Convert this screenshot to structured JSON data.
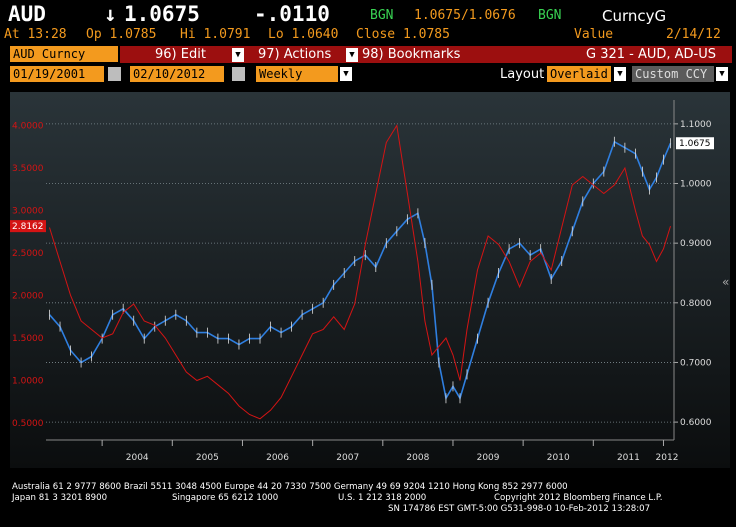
{
  "ticker": {
    "symbol": "AUD",
    "arrow": "↓",
    "price": "1.0675",
    "change": "-.0110",
    "source1": "BGN",
    "bidask": "1.0675/1.0676",
    "source2": "BGN",
    "function": "CurncyG"
  },
  "quote": {
    "time_label": "At 13:28",
    "open": "Op 1.0785",
    "high": "Hi 1.0791",
    "low": "Lo 1.0640",
    "close": "Close 1.0785",
    "value_label": "Value",
    "value_date": "2/14/12"
  },
  "menu": {
    "security": "AUD Curncy",
    "edit": "96) Edit",
    "actions": "97) Actions",
    "bookmarks": "98) Bookmarks",
    "chart_id": "G 321 - AUD, AD-US"
  },
  "range": {
    "start_date": "01/19/2001",
    "end_date": "02/10/2012",
    "period": "Weekly",
    "layout_label": "Layout",
    "layout_value": "Overlaid",
    "currency_value": "Custom CCY"
  },
  "colors": {
    "orange": "#f39a1e",
    "menu_red": "#9c0f0f",
    "series_aud": "#2f7fe0",
    "series_spread": "#d41414",
    "price_tag": "#ffffff",
    "left_tag": "#d41414"
  },
  "chart_data": {
    "type": "line",
    "x_ticks": [
      "2004",
      "2005",
      "2006",
      "2007",
      "2008",
      "2009",
      "2010",
      "2011",
      "2012"
    ],
    "left_axis": {
      "ticks": [
        "0.5000",
        "1.0000",
        "1.5000",
        "2.0000",
        "2.5000",
        "3.0000",
        "3.5000",
        "4.0000"
      ],
      "range": [
        0.3,
        4.3
      ],
      "current_tag": "2.8162"
    },
    "right_axis": {
      "ticks": [
        "0.6000",
        "0.7000",
        "0.8000",
        "0.9000",
        "1.0000",
        "1.1000"
      ],
      "range": [
        0.57,
        1.14
      ],
      "current_tag": "1.0675"
    },
    "series": [
      {
        "axis": "right",
        "x": [
          2003.25,
          2003.4,
          2003.55,
          2003.7,
          2003.85,
          2004.0,
          2004.15,
          2004.3,
          2004.45,
          2004.6,
          2004.75,
          2004.9,
          2005.05,
          2005.2,
          2005.35,
          2005.5,
          2005.65,
          2005.8,
          2005.95,
          2006.1,
          2006.25,
          2006.4,
          2006.55,
          2006.7,
          2006.85,
          2007.0,
          2007.15,
          2007.3,
          2007.45,
          2007.6,
          2007.75,
          2007.9,
          2008.05,
          2008.2,
          2008.35,
          2008.5,
          2008.6,
          2008.7,
          2008.8,
          2008.9,
          2009.0,
          2009.1,
          2009.2,
          2009.35,
          2009.5,
          2009.65,
          2009.8,
          2009.95,
          2010.1,
          2010.25,
          2010.4,
          2010.55,
          2010.7,
          2010.85,
          2011.0,
          2011.15,
          2011.3,
          2011.45,
          2011.6,
          2011.7,
          2011.8,
          2011.9,
          2012.0,
          2012.1
        ],
        "values": [
          0.78,
          0.76,
          0.72,
          0.7,
          0.71,
          0.74,
          0.78,
          0.79,
          0.77,
          0.74,
          0.76,
          0.77,
          0.78,
          0.77,
          0.75,
          0.75,
          0.74,
          0.74,
          0.73,
          0.74,
          0.74,
          0.76,
          0.75,
          0.76,
          0.78,
          0.79,
          0.8,
          0.83,
          0.85,
          0.87,
          0.88,
          0.86,
          0.9,
          0.92,
          0.94,
          0.95,
          0.9,
          0.83,
          0.7,
          0.64,
          0.66,
          0.64,
          0.68,
          0.74,
          0.8,
          0.85,
          0.89,
          0.9,
          0.88,
          0.89,
          0.84,
          0.87,
          0.92,
          0.97,
          1.0,
          1.02,
          1.07,
          1.06,
          1.05,
          1.02,
          0.99,
          1.01,
          1.04,
          1.0675
        ]
      },
      {
        "axis": "left",
        "x": [
          2003.25,
          2003.4,
          2003.55,
          2003.7,
          2003.85,
          2004.0,
          2004.15,
          2004.3,
          2004.45,
          2004.6,
          2004.75,
          2004.9,
          2005.05,
          2005.2,
          2005.35,
          2005.5,
          2005.65,
          2005.8,
          2005.95,
          2006.1,
          2006.25,
          2006.4,
          2006.55,
          2006.7,
          2006.85,
          2007.0,
          2007.15,
          2007.3,
          2007.45,
          2007.6,
          2007.75,
          2007.9,
          2008.05,
          2008.2,
          2008.35,
          2008.5,
          2008.6,
          2008.7,
          2008.8,
          2008.9,
          2009.0,
          2009.1,
          2009.2,
          2009.35,
          2009.5,
          2009.65,
          2009.8,
          2009.95,
          2010.1,
          2010.25,
          2010.4,
          2010.55,
          2010.7,
          2010.85,
          2011.0,
          2011.15,
          2011.3,
          2011.45,
          2011.6,
          2011.7,
          2011.8,
          2011.9,
          2012.0,
          2012.1
        ],
        "values": [
          2.8,
          2.4,
          2.0,
          1.7,
          1.6,
          1.5,
          1.55,
          1.8,
          1.9,
          1.7,
          1.65,
          1.5,
          1.3,
          1.1,
          1.0,
          1.05,
          0.95,
          0.85,
          0.7,
          0.6,
          0.55,
          0.65,
          0.8,
          1.05,
          1.3,
          1.55,
          1.6,
          1.75,
          1.6,
          1.9,
          2.6,
          3.2,
          3.8,
          4.0,
          3.2,
          2.4,
          1.7,
          1.3,
          1.4,
          1.5,
          1.3,
          1.0,
          1.6,
          2.3,
          2.7,
          2.6,
          2.4,
          2.1,
          2.4,
          2.5,
          2.3,
          2.8,
          3.3,
          3.4,
          3.3,
          3.2,
          3.3,
          3.5,
          3.0,
          2.7,
          2.6,
          2.4,
          2.55,
          2.8162
        ]
      }
    ]
  },
  "footer": {
    "line1": "Australia 61 2 9777 8600 Brazil 5511 3048 4500 Europe 44 20 7330 7500 Germany 49 69 9204 1210 Hong Kong 852 2977 6000",
    "line2_left": "Japan 81 3 3201 8900",
    "line2_mid": "Singapore 65 6212 1000",
    "line2_mid2": "U.S. 1 212 318 2000",
    "line2_right": "Copyright 2012 Bloomberg Finance L.P.",
    "line3": "SN 174786 EST   GMT-5:00 G531-998-0 10-Feb-2012 13:28:07"
  }
}
